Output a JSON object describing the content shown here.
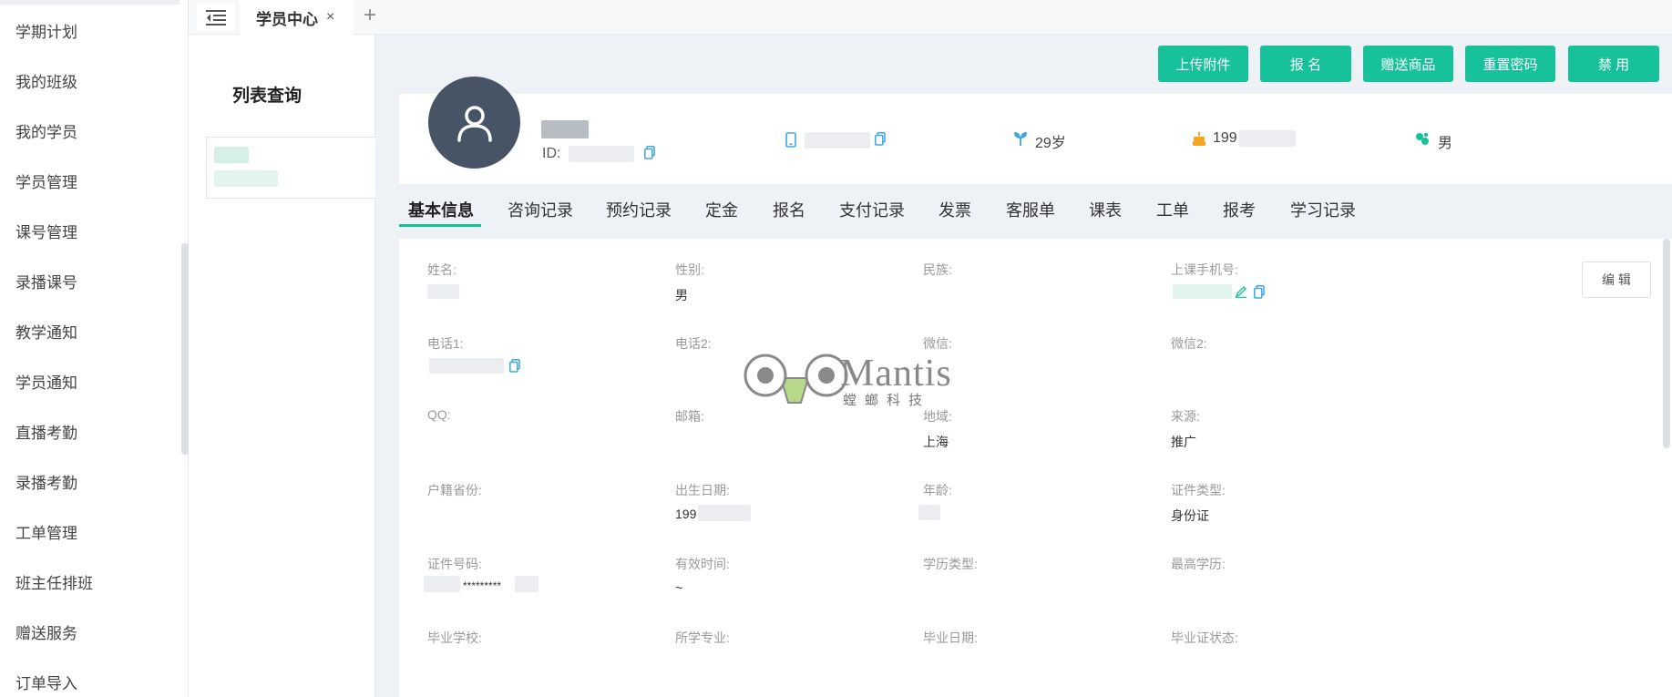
{
  "sidebar": {
    "items": [
      {
        "label": "学期计划"
      },
      {
        "label": "我的班级"
      },
      {
        "label": "我的学员"
      },
      {
        "label": "学员管理"
      },
      {
        "label": "课号管理"
      },
      {
        "label": "录播课号"
      },
      {
        "label": "教学通知"
      },
      {
        "label": "学员通知"
      },
      {
        "label": "直播考勤"
      },
      {
        "label": "录播考勤"
      },
      {
        "label": "工单管理"
      },
      {
        "label": "班主任排班"
      },
      {
        "label": "赠送服务"
      },
      {
        "label": "订单导入"
      }
    ]
  },
  "tabbar": {
    "active_tab": "学员中心",
    "close_glyph": "×",
    "add_glyph": "+"
  },
  "list_panel": {
    "title": "列表查询"
  },
  "actions": {
    "upload": "上传附件",
    "enroll": "报 名",
    "gift": "赠送商品",
    "reset_password": "重置密码",
    "disable": "禁 用"
  },
  "profile": {
    "id_label": "ID:",
    "age": "29岁",
    "birth_prefix": "199",
    "gender": "男"
  },
  "content_tabs": [
    "基本信息",
    "咨询记录",
    "预约记录",
    "定金",
    "报名",
    "支付记录",
    "发票",
    "客服单",
    "课表",
    "工单",
    "报考",
    "学习记录"
  ],
  "details": {
    "edit_label": "编 辑",
    "fields": [
      {
        "label": "姓名:",
        "value": ""
      },
      {
        "label": "性别:",
        "value": "男"
      },
      {
        "label": "民族:",
        "value": ""
      },
      {
        "label": "上课手机号:",
        "value": ""
      },
      {
        "label": "电话1:",
        "value": ""
      },
      {
        "label": "电话2:",
        "value": ""
      },
      {
        "label": "微信:",
        "value": ""
      },
      {
        "label": "微信2:",
        "value": ""
      },
      {
        "label": "QQ:",
        "value": ""
      },
      {
        "label": "邮箱:",
        "value": ""
      },
      {
        "label": "地域:",
        "value": "上海"
      },
      {
        "label": "来源:",
        "value": "推广"
      },
      {
        "label": "户籍省份:",
        "value": ""
      },
      {
        "label": "出生日期:",
        "value": "199"
      },
      {
        "label": "年龄:",
        "value": ""
      },
      {
        "label": "证件类型:",
        "value": "身份证"
      },
      {
        "label": "证件号码:",
        "value": "*********"
      },
      {
        "label": "有效时间:",
        "value": "~"
      },
      {
        "label": "学历类型:",
        "value": ""
      },
      {
        "label": "最高学历:",
        "value": ""
      },
      {
        "label": "毕业学校:",
        "value": ""
      },
      {
        "label": "所学专业:",
        "value": ""
      },
      {
        "label": "毕业日期:",
        "value": ""
      },
      {
        "label": "毕业证状态:",
        "value": ""
      }
    ]
  },
  "watermark": {
    "name": "Mantis",
    "subtitle": "螳螂科技"
  },
  "colors": {
    "accent": "#17c29a",
    "avatar_bg": "#475466",
    "icon_blue": "#3aa7e6",
    "icon_orange": "#f5a623"
  }
}
